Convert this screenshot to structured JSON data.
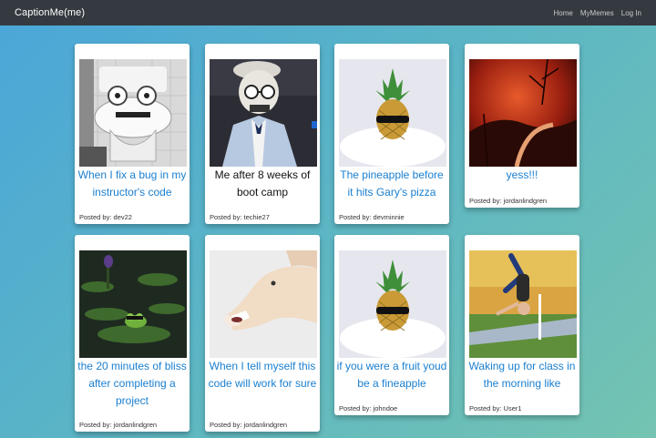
{
  "nav": {
    "brand": "CaptionMe(me)",
    "links": [
      "Home",
      "MyMemes",
      "Log In"
    ]
  },
  "memes": [
    {
      "caption": "When I fix a bug in my instructor's code",
      "posted_by": "Posted by: dev22",
      "image": "toilet-with-glasses-photo"
    },
    {
      "caption": "Me after 8 weeks of boot camp",
      "posted_by": "Posted by: techie27",
      "image": "skeleton-in-suit-photo"
    },
    {
      "caption": "The pineapple before it hits Gary's pizza",
      "posted_by": "Posted by: devminnie",
      "image": "pineapple-sunglasses-photo"
    },
    {
      "caption": "yess!!!",
      "posted_by": "Posted by: jordanlindgren",
      "image": "red-sky-path-photo"
    },
    {
      "caption": "the 20 minutes of bliss after completing a project",
      "posted_by": "Posted by: jordanlindgren",
      "image": "frog-on-lily-pad-photo"
    },
    {
      "caption": "When I tell myself this code will work for sure",
      "posted_by": "Posted by: jordanlindgren",
      "image": "laughing-horse-photo"
    },
    {
      "caption": "if you were a fruit youd be a fineapple",
      "posted_by": "Posted by: johndoe",
      "image": "pineapple-sunglasses-photo"
    },
    {
      "caption": "Waking up for class in the morning like",
      "posted_by": "Posted by: User1",
      "image": "breakdancer-photo"
    }
  ],
  "colors": {
    "navbar": "#343a40",
    "link_caption": "#1a7fd0",
    "background_start": "#4aa6d9",
    "background_end": "#74c4b1"
  }
}
